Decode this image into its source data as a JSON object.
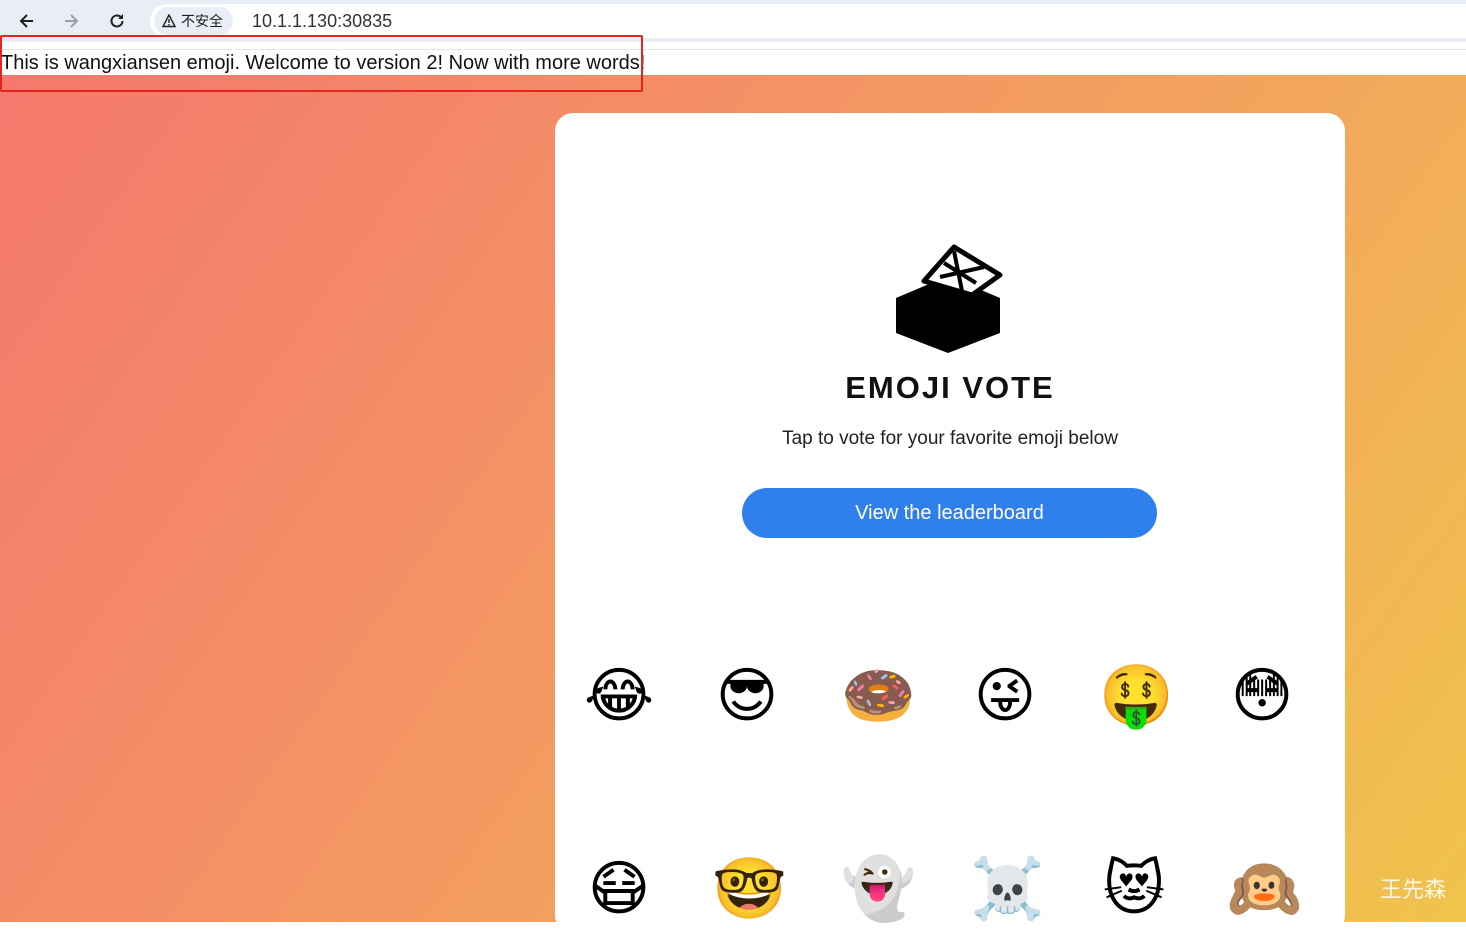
{
  "browser": {
    "security_label": "不安全",
    "url": "10.1.1.130:30835"
  },
  "banner": {
    "text": "This is wangxiansen emoji. Welcome to version 2! Now with more words!"
  },
  "card": {
    "title": "EMOJI VOTE",
    "subtitle": "Tap to vote for your favorite emoji below",
    "leaderboard_button": "View the leaderboard"
  },
  "emojis": {
    "row1": [
      "😂",
      "😎",
      "🍩",
      "😜",
      "🤑",
      "😳"
    ],
    "row2": [
      "😷",
      "🤓",
      "👻",
      "☠️",
      "😻",
      "🙉"
    ]
  },
  "watermark": "王先森",
  "colors": {
    "button": "#2f80ed",
    "highlight_border": "#e8231c",
    "gradient_start": "#f5786c",
    "gradient_end": "#f0c44c"
  }
}
